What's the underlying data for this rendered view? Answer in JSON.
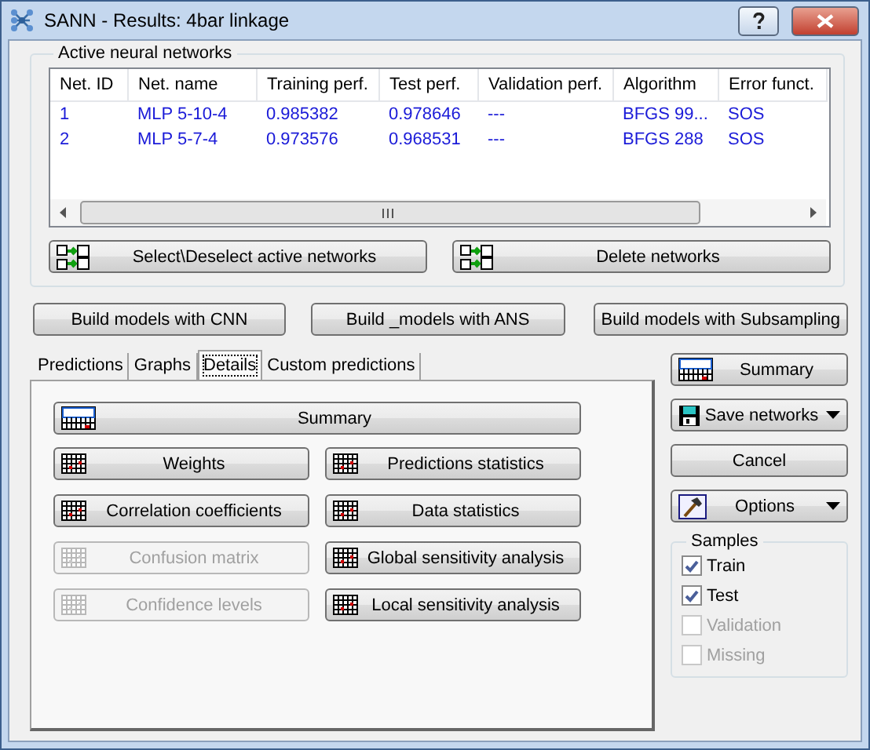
{
  "window": {
    "title": "SANN - Results: 4bar linkage",
    "controls": [
      {
        "kind": "help"
      },
      {
        "kind": "close"
      }
    ]
  },
  "networks": {
    "label": "Active neural networks",
    "columns": [
      "Net. ID",
      "Net. name",
      "Training perf.",
      "Test perf.",
      "Validation perf.",
      "Algorithm",
      "Error funct."
    ],
    "rows": [
      {
        "cells": [
          "1",
          "MLP 5-10-4",
          "0.985382",
          "0.978646",
          "---",
          "BFGS 99...",
          "SOS"
        ]
      },
      {
        "cells": [
          "2",
          "MLP 5-7-4",
          "0.973576",
          "0.968531",
          "---",
          "BFGS 288",
          "SOS"
        ]
      }
    ],
    "buttons": [
      "Select\\Deselect active networks",
      "Delete networks"
    ]
  },
  "build_buttons": [
    "Build models with CNN",
    "Build _models with ANS",
    "Build models with Subsampling"
  ],
  "tabs": [
    {
      "label": "Predictions",
      "selected": false
    },
    {
      "label": "Graphs",
      "selected": false
    },
    {
      "label": "Details",
      "selected": true
    },
    {
      "label": "Custom predictions",
      "selected": false
    }
  ],
  "details": {
    "summary": "Summary",
    "buttons": [
      {
        "label": "Weights",
        "disabled": false
      },
      {
        "label": "Predictions statistics",
        "disabled": false
      },
      {
        "label": "Correlation coefficients",
        "disabled": false
      },
      {
        "label": "Data statistics",
        "disabled": false
      },
      {
        "label": "Confusion matrix",
        "disabled": true
      },
      {
        "label": "Global sensitivity analysis",
        "disabled": false
      },
      {
        "label": "Confidence levels",
        "disabled": true
      },
      {
        "label": "Local sensitivity analysis",
        "disabled": false
      }
    ]
  },
  "side_buttons": [
    {
      "label": "Summary",
      "kind": "summary"
    },
    {
      "label": "Save networks",
      "kind": "save"
    },
    {
      "label": "Cancel",
      "kind": "plain"
    },
    {
      "label": "Options",
      "kind": "options"
    }
  ],
  "samples": {
    "label": "Samples",
    "items": [
      {
        "label": "Train",
        "checked": true,
        "disabled": false
      },
      {
        "label": "Test",
        "checked": true,
        "disabled": false
      },
      {
        "label": "Validation",
        "checked": false,
        "disabled": true
      },
      {
        "label": "Missing",
        "checked": false,
        "disabled": true
      }
    ]
  }
}
